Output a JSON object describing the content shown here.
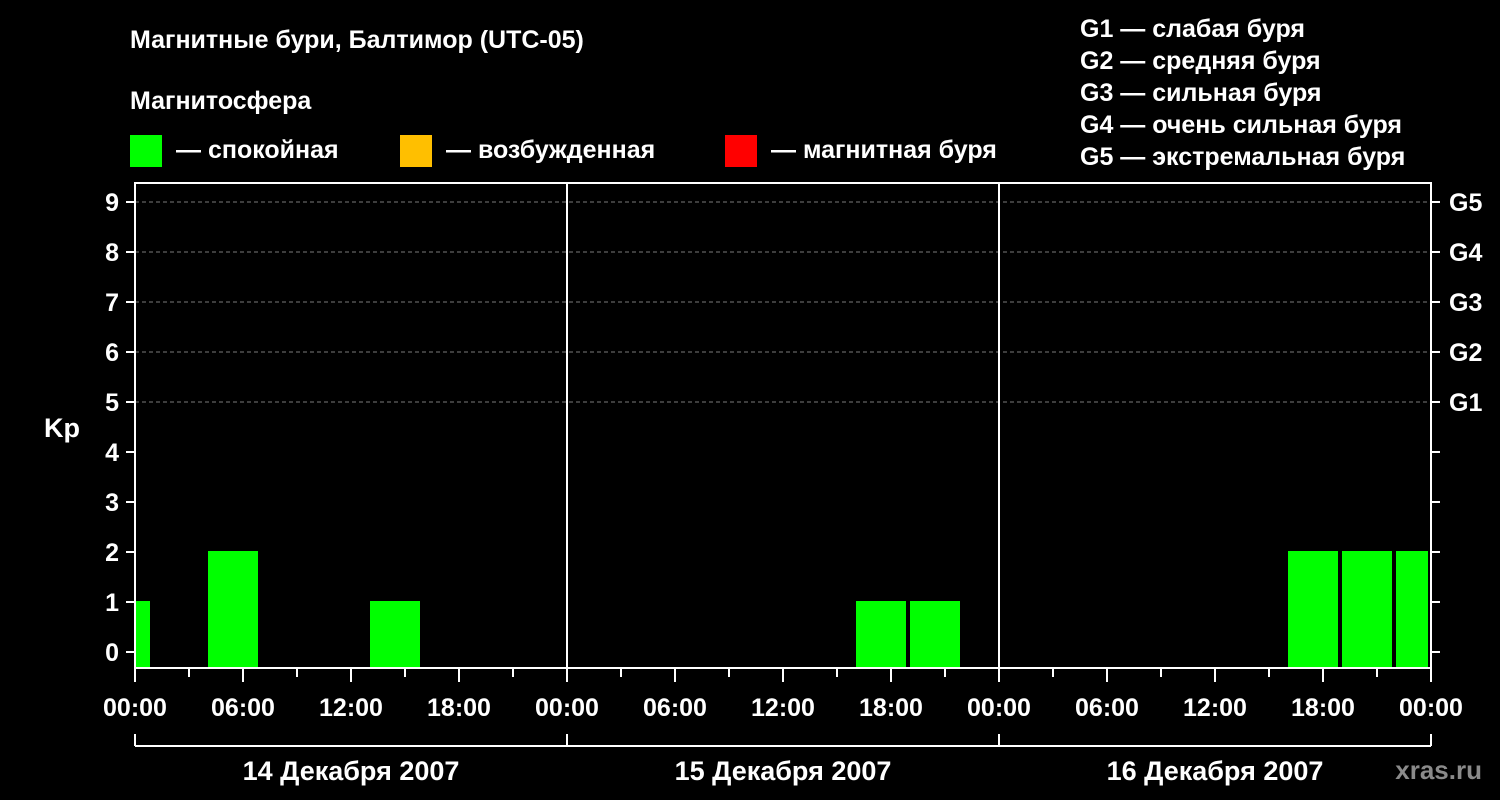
{
  "chart_data": {
    "type": "bar",
    "title": "Магнитные бури, Балтимор (UTC-05)",
    "legend": {
      "heading": "Магнитосфера",
      "items": [
        {
          "label": "— спокойная",
          "color": "#00ff00"
        },
        {
          "label": "— возбужденная",
          "color": "#ffbf00"
        },
        {
          "label": "— магнитная буря",
          "color": "#ff0000"
        }
      ]
    },
    "g_scale_legend": [
      "G1 — слабая буря",
      "G2 — средняя буря",
      "G3 — сильная буря",
      "G4 — очень сильная буря",
      "G5 — экстремальная буря"
    ],
    "ylabel": "Kp",
    "ylim": [
      0,
      9
    ],
    "y_ticks": [
      "0",
      "1",
      "2",
      "3",
      "4",
      "5",
      "6",
      "7",
      "8",
      "9"
    ],
    "right_ticks": [
      {
        "kp": 5,
        "label": "G1"
      },
      {
        "kp": 6,
        "label": "G2"
      },
      {
        "kp": 7,
        "label": "G3"
      },
      {
        "kp": 8,
        "label": "G4"
      },
      {
        "kp": 9,
        "label": "G5"
      }
    ],
    "x_range_hours": [
      0,
      72
    ],
    "x_tick_labels": [
      "00:00",
      "06:00",
      "12:00",
      "18:00",
      "00:00",
      "06:00",
      "12:00",
      "18:00",
      "00:00",
      "06:00",
      "12:00",
      "18:00",
      "00:00"
    ],
    "days": [
      "14 Декабря 2007",
      "15 Декабря 2007",
      "16 Декабря 2007"
    ],
    "grid": true,
    "bar_color": "#00ff00",
    "bars": [
      {
        "start_time": "14 Dec 2007 00:00",
        "end_time": "14 Dec 2007 01:00",
        "kp": 1
      },
      {
        "start_time": "14 Dec 2007 04:00",
        "end_time": "14 Dec 2007 07:00",
        "kp": 2
      },
      {
        "start_time": "14 Dec 2007 13:00",
        "end_time": "14 Dec 2007 16:00",
        "kp": 1
      },
      {
        "start_time": "15 Dec 2007 16:00",
        "end_time": "15 Dec 2007 19:00",
        "kp": 1
      },
      {
        "start_time": "15 Dec 2007 19:00",
        "end_time": "15 Dec 2007 22:00",
        "kp": 1
      },
      {
        "start_time": "16 Dec 2007 16:00",
        "end_time": "16 Dec 2007 19:00",
        "kp": 2
      },
      {
        "start_time": "16 Dec 2007 19:00",
        "end_time": "16 Dec 2007 22:00",
        "kp": 2
      },
      {
        "start_time": "16 Dec 2007 22:00",
        "end_time": "17 Dec 2007 00:00",
        "kp": 2
      }
    ]
  },
  "watermark": "xras.ru"
}
